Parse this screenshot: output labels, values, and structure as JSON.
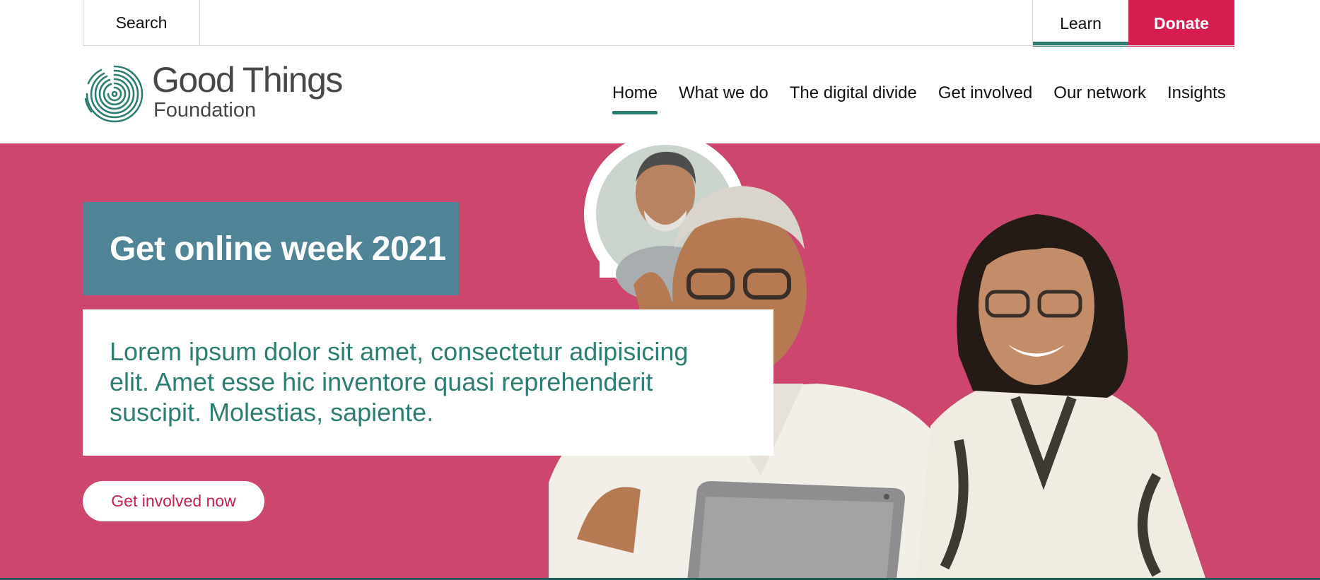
{
  "topbar": {
    "search_label": "Search",
    "learn_label": "Learn",
    "donate_label": "Donate"
  },
  "logo": {
    "title": "Good Things",
    "subtitle": "Foundation"
  },
  "nav": {
    "items": [
      {
        "label": "Home",
        "active": true
      },
      {
        "label": "What we do"
      },
      {
        "label": "The digital divide"
      },
      {
        "label": "Get involved"
      },
      {
        "label": "Our network"
      },
      {
        "label": "Insights"
      }
    ]
  },
  "hero": {
    "headline": "Get online week 2021",
    "body": "Lorem ipsum dolor sit amet, consectetur adipisicing elit. Amet esse hic inventore quasi reprehenderit suscipit. Molestias, sapiente.",
    "cta_label": "Get involved now"
  },
  "colors": {
    "accent_green": "#2e7d73",
    "donate_red": "#d51d4f",
    "hero_pink": "#cc466e",
    "headline_blue": "#4f8496"
  }
}
